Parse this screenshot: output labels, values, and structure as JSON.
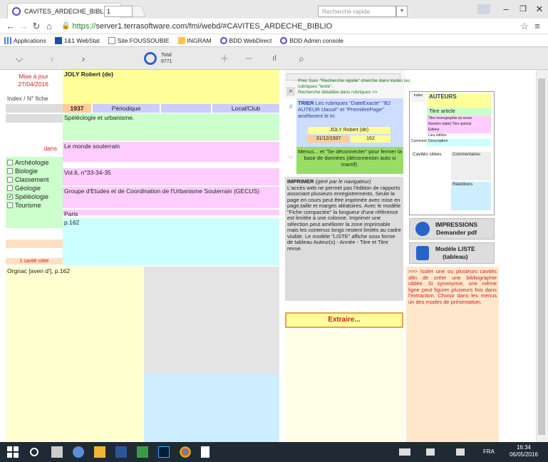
{
  "browser": {
    "tab_title": "CAVITES_ARDECHE_BIBLIO",
    "url_secure": "https://",
    "url_rest": "server1.terrasoftware.com/fmi/webd/#CAVITES_ARDECHE_BIBLIO",
    "bookmarks": [
      "Applications",
      "1&1 WebStat",
      "Site FOUSSOUBIE",
      "INGRAM",
      "BDD WebDirect",
      "BDD Admin console"
    ]
  },
  "toolbar": {
    "record_number": "1",
    "total_label": "Total",
    "total_value": "8771",
    "search_placeholder": "Recherche rapide"
  },
  "record": {
    "update_label": "Mise à jour",
    "update_date": "27/04/2016",
    "author": "JOLY Robert (de)",
    "index_label": "Index / N° fiche",
    "year": "1937",
    "type": "Périodique",
    "scope": "Local/Club",
    "title": "Spéléologie et urbanisme.",
    "dans_label": "dans",
    "source": "Le monde souterrain",
    "volume": "Vol.6, n°33-34-35",
    "publisher": "Groupe d'Etudes et de Coordination de l'Urbanisme Souterrain (GECUS)",
    "city": "Paris",
    "pages": "p.162",
    "cavity_count_label": "1 cavité citée",
    "cavity": "Orgnac [aven d'], p.162"
  },
  "categories": [
    {
      "label": "Archéologie",
      "checked": false
    },
    {
      "label": "Biologie",
      "checked": false
    },
    {
      "label": "Classement",
      "checked": false
    },
    {
      "label": "Géologie",
      "checked": false
    },
    {
      "label": "Spéléologie",
      "checked": true
    },
    {
      "label": "Tourisme",
      "checked": false
    }
  ],
  "help": {
    "search_tip_line1": "Préc Suiv. \"Recherche rapide\" cherche dans toutes les rubriques \"texte\".",
    "search_tip_line2": "Recherche détaillée dans rubriques >>",
    "sort_title": "TRIER",
    "sort_text": "Les rubriques \"DateExacte\" \"B2 AUTEUR classé\" et \"PremièrePage\" améliorent le tri.",
    "sort_author": "JOLY Robert (de)",
    "sort_date": "31/12/1937",
    "sort_page": "162",
    "menu_text": "Menus... et \"Se déconnecter\" pour fermer la base de données (déconnexion auto si inactif).",
    "print_title": "IMPRIMER",
    "print_sub": "(géré par le navigateur)",
    "print_text": "L'accès web ne permet pas l'édition de rapports associant plusieurs enregistrements. Seule la page en cours peut être imprimée avec mise en page,taille et marges aléatoires. Avec le modèle \"Fiche compactée\" la longueur d'une référence est limitée à une colonne. Imprimer une sélection peut améliorer la zone imprimable mais les contenus longs restent limités au cadre visible. Le modèle \"LISTE\" affiche sous forme de tableau Auteur(s) - Année - Titre et Titre revue.",
    "extract_button": "Extraire...",
    "extract_note": ">>> Isoler une ou plusieurs cavités afin de créer une bibliographie ciblée. Si synonymie, une même ligne peut figurer plusieurs fois dans l'extraction. Choisir dans les menus un des modes de présentation."
  },
  "preview": {
    "index": "Index",
    "authors": "AUTEURS",
    "article_title": "Titre article",
    "monograph": "Titre monographie ou revue",
    "issue": "Numéro (date) Titre spécial",
    "editor": "Editeur",
    "place": "Lieu édition",
    "comment": "Comment",
    "description": "Description",
    "cavities": "Cavités citées",
    "comments": "Commentaires",
    "reissues": "Rééditions"
  },
  "buttons": {
    "print_title": "IMPRESSIONS",
    "print_sub": "Demander pdf",
    "list_title": "Modèle LISTE",
    "list_sub": "(tableau)"
  },
  "taskbar": {
    "lang": "FRA",
    "time": "16:34",
    "date": "06/05/2016"
  }
}
